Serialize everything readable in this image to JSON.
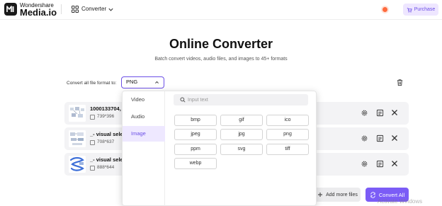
{
  "header": {
    "brand_top": "Wondershare",
    "brand_main": "Media.io",
    "nav_label": "Converter",
    "purchase_label": "Purchase",
    "accent_color": "#6b4fe6",
    "notification_color": "#ff6a3d"
  },
  "hero": {
    "title": "Online Converter",
    "subtitle": "Batch convert videos, audio files, and images to 45+ formats"
  },
  "format_bar": {
    "label": "Convert all file format to:",
    "selected_format": "PNG"
  },
  "files": [
    {
      "name": "1000133704,",
      "dimensions": "739*396"
    },
    {
      "name": "_- visual selec",
      "dimensions": "708*637"
    },
    {
      "name": "_- visual selec",
      "dimensions": "888*644"
    }
  ],
  "dropdown": {
    "categories": [
      {
        "label": "Video",
        "active": false
      },
      {
        "label": "Audio",
        "active": false
      },
      {
        "label": "Image",
        "active": true
      }
    ],
    "search_placeholder": "Input text",
    "formats": [
      "bmp",
      "gif",
      "ico",
      "jpeg",
      "jpg",
      "png",
      "ppm",
      "svg",
      "tiff",
      "webp"
    ]
  },
  "footer": {
    "add_more_label": "Add more files",
    "convert_all_label": "Convert All"
  },
  "watermark": "Activate Windows"
}
